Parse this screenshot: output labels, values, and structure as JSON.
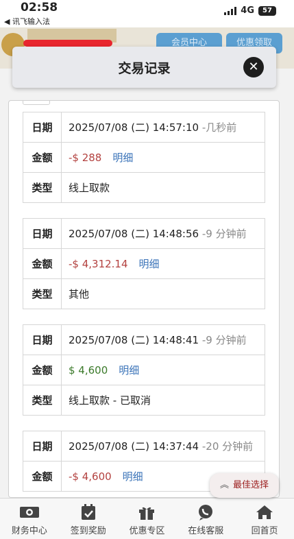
{
  "status_bar": {
    "time": "02:58",
    "back_app": "讯飞输入法",
    "network": "4G",
    "battery": "57"
  },
  "background": {
    "member_center": "会员中心",
    "promo_claim": "优惠领取"
  },
  "modal": {
    "title": "交易记录",
    "close_icon": "close-icon"
  },
  "labels": {
    "date": "日期",
    "amount": "金额",
    "type": "类型",
    "detail": "明细"
  },
  "records": [
    {
      "date": "2025/07/08 (二) 14:57:10",
      "ago": "-几秒前",
      "amount": "-$ 288",
      "amount_sign": "negative",
      "type": "线上取款"
    },
    {
      "date": "2025/07/08 (二) 14:48:56",
      "ago": "-9 分钟前",
      "amount": "-$ 4,312.14",
      "amount_sign": "negative",
      "type": "其他"
    },
    {
      "date": "2025/07/08 (二) 14:48:41",
      "ago": "-9 分钟前",
      "amount": "$ 4,600",
      "amount_sign": "positive",
      "type": "线上取款 - 已取消"
    },
    {
      "date": "2025/07/08 (二) 14:37:44",
      "ago": "-20 分钟前",
      "amount": "-$ 4,600",
      "amount_sign": "negative",
      "type": ""
    }
  ],
  "best_choice": {
    "label": "最佳选择",
    "icon": "double-chevron-up-icon"
  },
  "bottom_nav": [
    {
      "label": "财务中心",
      "icon": "cash-icon"
    },
    {
      "label": "签到奖励",
      "icon": "calendar-check-icon"
    },
    {
      "label": "优惠专区",
      "icon": "gift-icon"
    },
    {
      "label": "在线客服",
      "icon": "chat-phone-icon"
    },
    {
      "label": "回首页",
      "icon": "home-icon"
    }
  ],
  "colors": {
    "negative": "#b3413f",
    "positive": "#3b7a2a",
    "detail_link": "#3a73b8",
    "best_choice_text": "#9b1c1c"
  }
}
